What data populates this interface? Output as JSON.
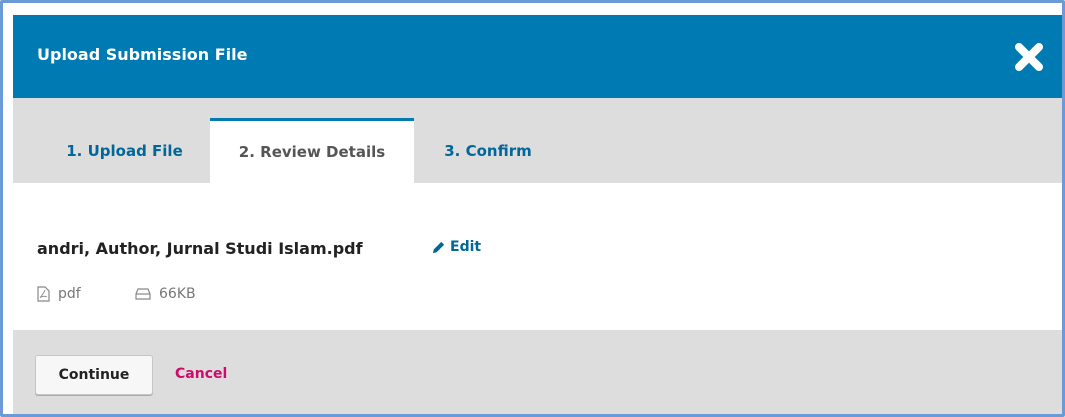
{
  "modal": {
    "title": "Upload Submission File",
    "close_icon": "close-x-icon"
  },
  "tabs": [
    {
      "label": "1. Upload File",
      "active": false
    },
    {
      "label": "2. Review Details",
      "active": true
    },
    {
      "label": "3. Confirm",
      "active": false
    }
  ],
  "file": {
    "name": "andri, Author, Jurnal Studi Islam.pdf",
    "edit_label": "Edit",
    "edit_icon": "pencil-icon",
    "type": "pdf",
    "type_icon": "file-pdf-icon",
    "size": "66KB",
    "size_icon": "hard-drive-icon"
  },
  "footer": {
    "continue_label": "Continue",
    "cancel_label": "Cancel"
  },
  "colors": {
    "header": "#007ab2",
    "link": "#006798",
    "cancel": "#d00a6c",
    "panel": "#dddddd"
  }
}
